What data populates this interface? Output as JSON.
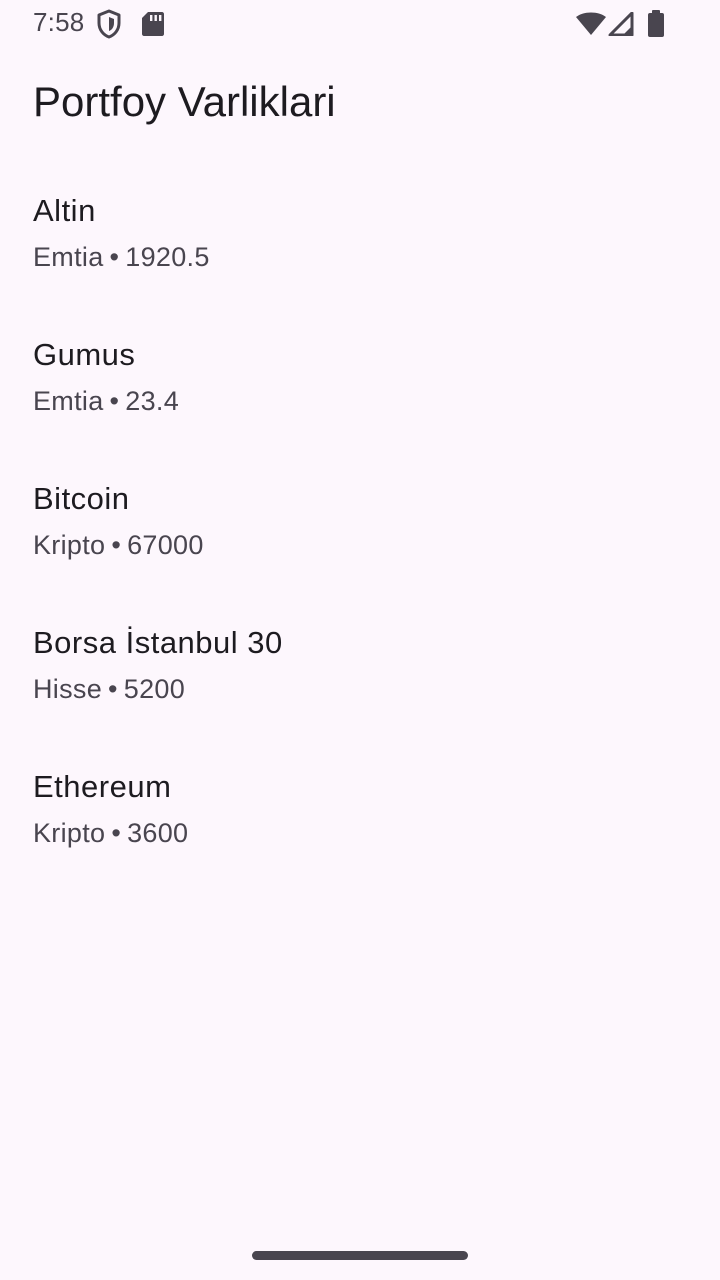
{
  "status_bar": {
    "time": "7:58",
    "icons": [
      "shield-icon",
      "sd-card-icon",
      "wifi-icon",
      "signal-icon",
      "battery-icon"
    ]
  },
  "app_bar": {
    "title": "Portfoy Varliklari"
  },
  "assets": [
    {
      "name": "Altin",
      "category": "Emtia",
      "separator": "•",
      "value": "1920.5"
    },
    {
      "name": "Gumus",
      "category": "Emtia",
      "separator": "•",
      "value": "23.4"
    },
    {
      "name": "Bitcoin",
      "category": "Kripto",
      "separator": "•",
      "value": "67000"
    },
    {
      "name": "Borsa İstanbul 30",
      "category": "Hisse",
      "separator": "•",
      "value": "5200"
    },
    {
      "name": "Ethereum",
      "category": "Kripto",
      "separator": "•",
      "value": "3600"
    }
  ],
  "colors": {
    "background": "#fdf7fd",
    "text_primary": "#1d1b20",
    "text_secondary": "#49454f"
  }
}
